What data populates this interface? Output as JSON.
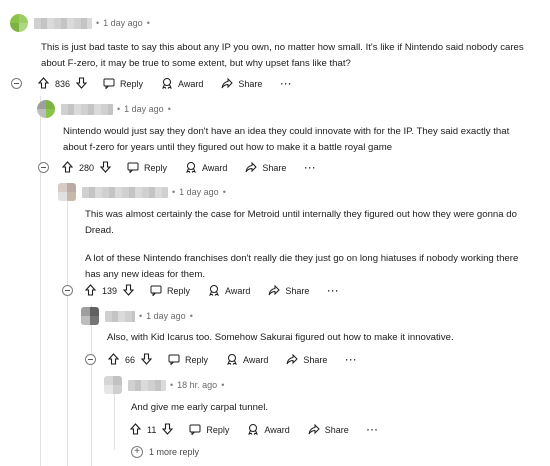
{
  "colors": {
    "avatar_green": "#8bc34a",
    "avatar_gray": "#9e9e9e",
    "text": "#1c1c1c",
    "meta": "#7c7c7c"
  },
  "comments": [
    {
      "time": "1 day ago",
      "paragraphs": [
        "This is just bad taste to say this about any IP you own, no matter how small. It's like if Nintendo said nobody cares",
        "about F-zero, it may be true to some extent, but why upset fans like that?"
      ],
      "votes": "836"
    },
    {
      "time": "1 day ago",
      "paragraphs": [
        "Nintendo would just say they don't have an idea they could innovate with for the IP. They said exactly that",
        "about f-zero for years until they figured out how to make it a battle royal game"
      ],
      "votes": "280"
    },
    {
      "time": "1 day ago",
      "paragraphs": [
        "This was almost certainly the case for Metroid until internally they figured out how they were gonna do",
        "Dread.",
        "A lot of these Nintendo franchises don't really die they just go on long hiatuses if nobody working there",
        "has any new ideas for them."
      ],
      "votes": "139"
    },
    {
      "time": "1 day ago",
      "paragraphs": [
        "Also, with Kid Icarus too. Somehow Sakurai figured out how to make it innovative."
      ],
      "votes": "66"
    },
    {
      "time": "18 hr. ago",
      "paragraphs": [
        "And give me early carpal tunnel."
      ],
      "votes": "11"
    }
  ],
  "actions": {
    "reply": "Reply",
    "award": "Award",
    "share": "Share",
    "more": "···"
  },
  "separator": "•",
  "more_replies": "1 more reply"
}
